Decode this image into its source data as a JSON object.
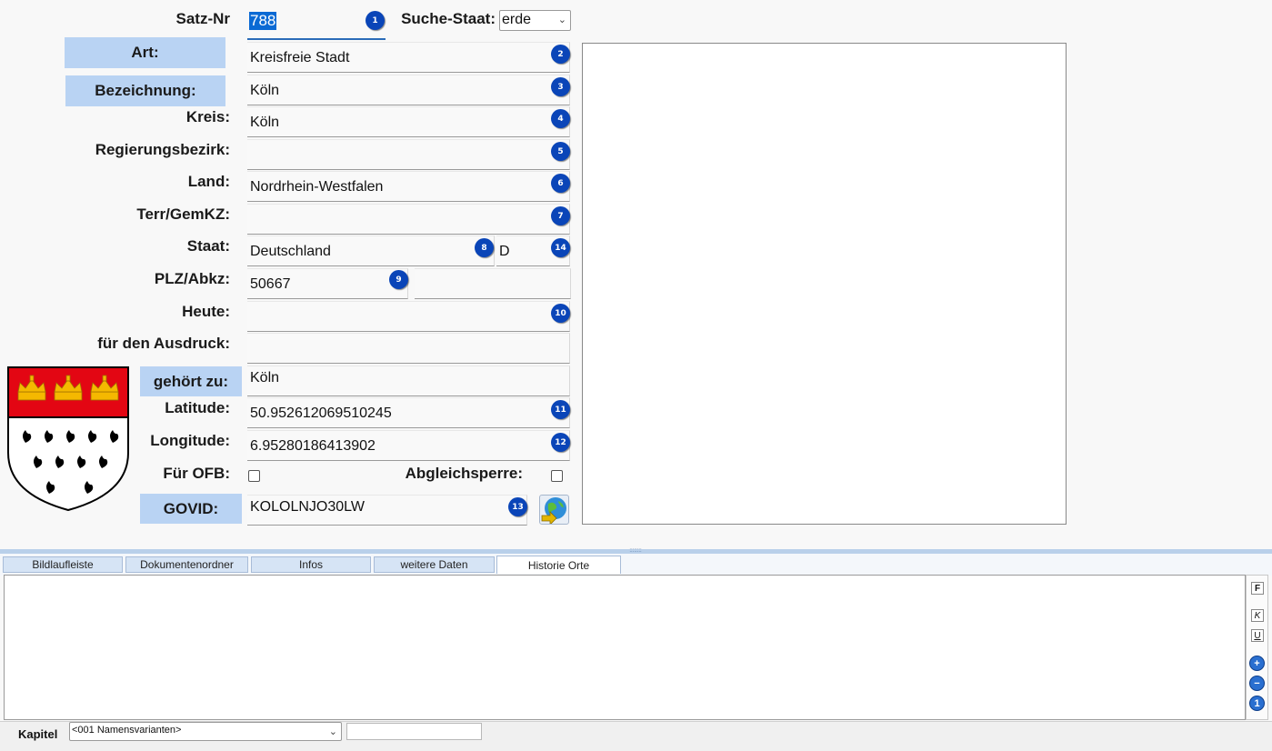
{
  "form": {
    "satz_nr_label": "Satz-Nr",
    "satz_nr_value": "788",
    "suche_staat_label": "Suche-Staat:",
    "suche_staat_value": "erde",
    "art_label": "Art:",
    "art_value": "Kreisfreie Stadt",
    "bezeichnung_label": "Bezeichnung:",
    "bezeichnung_value": "Köln",
    "kreis_label": "Kreis:",
    "kreis_value": "Köln",
    "regierungsbezirk_label": "Regierungsbezirk:",
    "regierungsbezirk_value": "",
    "land_label": "Land:",
    "land_value": "Nordrhein-Westfalen",
    "terr_label": "Terr/GemKZ:",
    "terr_value": "",
    "staat_label": "Staat:",
    "staat_value": "Deutschland",
    "staat_code": "D",
    "plz_label": "PLZ/Abkz:",
    "plz_value": "50667",
    "abkz_value": "",
    "heute_label": "Heute:",
    "heute_value": "",
    "ausdruck_label": "für den Ausdruck:",
    "ausdruck_value": "",
    "gehoert_label": "gehört zu:",
    "gehoert_value": "Köln",
    "latitude_label": "Latitude:",
    "latitude_value": "50.952612069510245",
    "longitude_label": "Longitude:",
    "longitude_value": "6.95280186413902",
    "ofb_label": "Für OFB:",
    "ofb_checked": false,
    "abgleich_label": "Abgleichsperre:",
    "abgleich_checked": false,
    "govid_label": "GOVID:",
    "govid_value": "KOLOLNJO30LW"
  },
  "badges": [
    "1",
    "2",
    "3",
    "4",
    "5",
    "6",
    "7",
    "8",
    "14",
    "9",
    "10",
    "11",
    "12",
    "13"
  ],
  "tabs": [
    {
      "label": "Bildlaufleiste",
      "active": false
    },
    {
      "label": "Dokumentenordner",
      "active": false
    },
    {
      "label": "Infos",
      "active": false
    },
    {
      "label": "weitere Daten",
      "active": false
    },
    {
      "label": "Historie Orte",
      "active": true
    }
  ],
  "format_toolbar": {
    "bold": "F",
    "italic": "K",
    "underline": "U"
  },
  "footer": {
    "kapitel_label": "Kapitel",
    "kapitel_value": "<001 Namensvarianten>"
  },
  "colors": {
    "label_button_bg": "#b9d3f3",
    "badge_blue": "#0a45b8",
    "coat_red": "#e30613",
    "coat_gold": "#f5b800"
  },
  "icons": {
    "globe": "globe-arrow-icon",
    "coat_of_arms": "cologne-coat-of-arms"
  }
}
